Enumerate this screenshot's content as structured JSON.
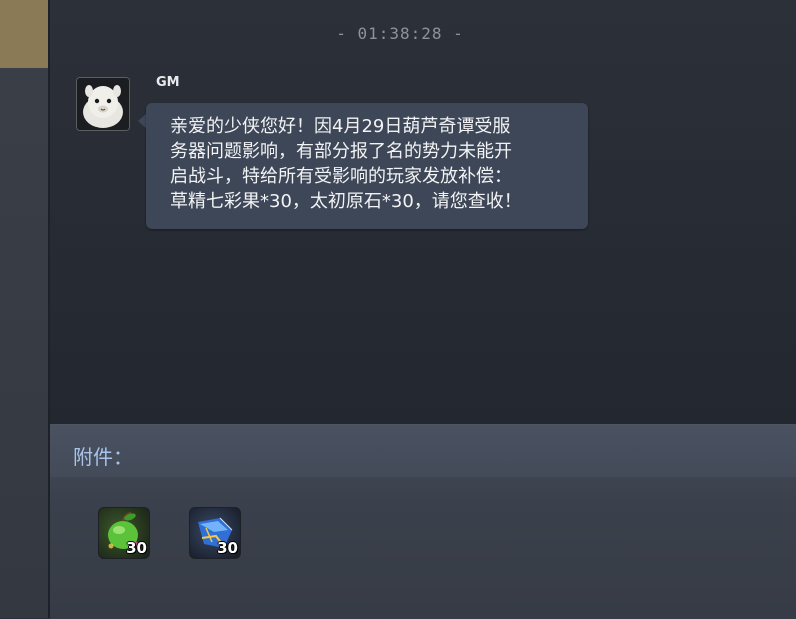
{
  "timestamp": "- 01:38:28 -",
  "message": {
    "sender": "GM",
    "avatar_icon": "alpaca-avatar-icon",
    "text": "亲爱的少侠您好！因4月29日葫芦奇谭受服务器问题影响，有部分报了名的势力未能开启战斗，特给所有受影响的玩家发放补偿：草精七彩果*30，太初原石*30，请您查收！",
    "lines": [
      "亲爱的少侠您好！因4月29日葫芦奇谭受服",
      "务器问题影响，有部分报了名的势力未能开",
      "启战斗，特给所有受影响的玩家发放补偿：",
      "草精七彩果*30，太初原石*30，请您查收！"
    ]
  },
  "attachments": {
    "label": "附件：",
    "items": [
      {
        "icon": "green-fruit-icon",
        "count": "30"
      },
      {
        "icon": "blue-crystal-icon",
        "count": "30"
      }
    ]
  },
  "colors": {
    "bubble": "#3e4757",
    "attach_label": "#a9c4e8",
    "background": "#2a2f38"
  }
}
